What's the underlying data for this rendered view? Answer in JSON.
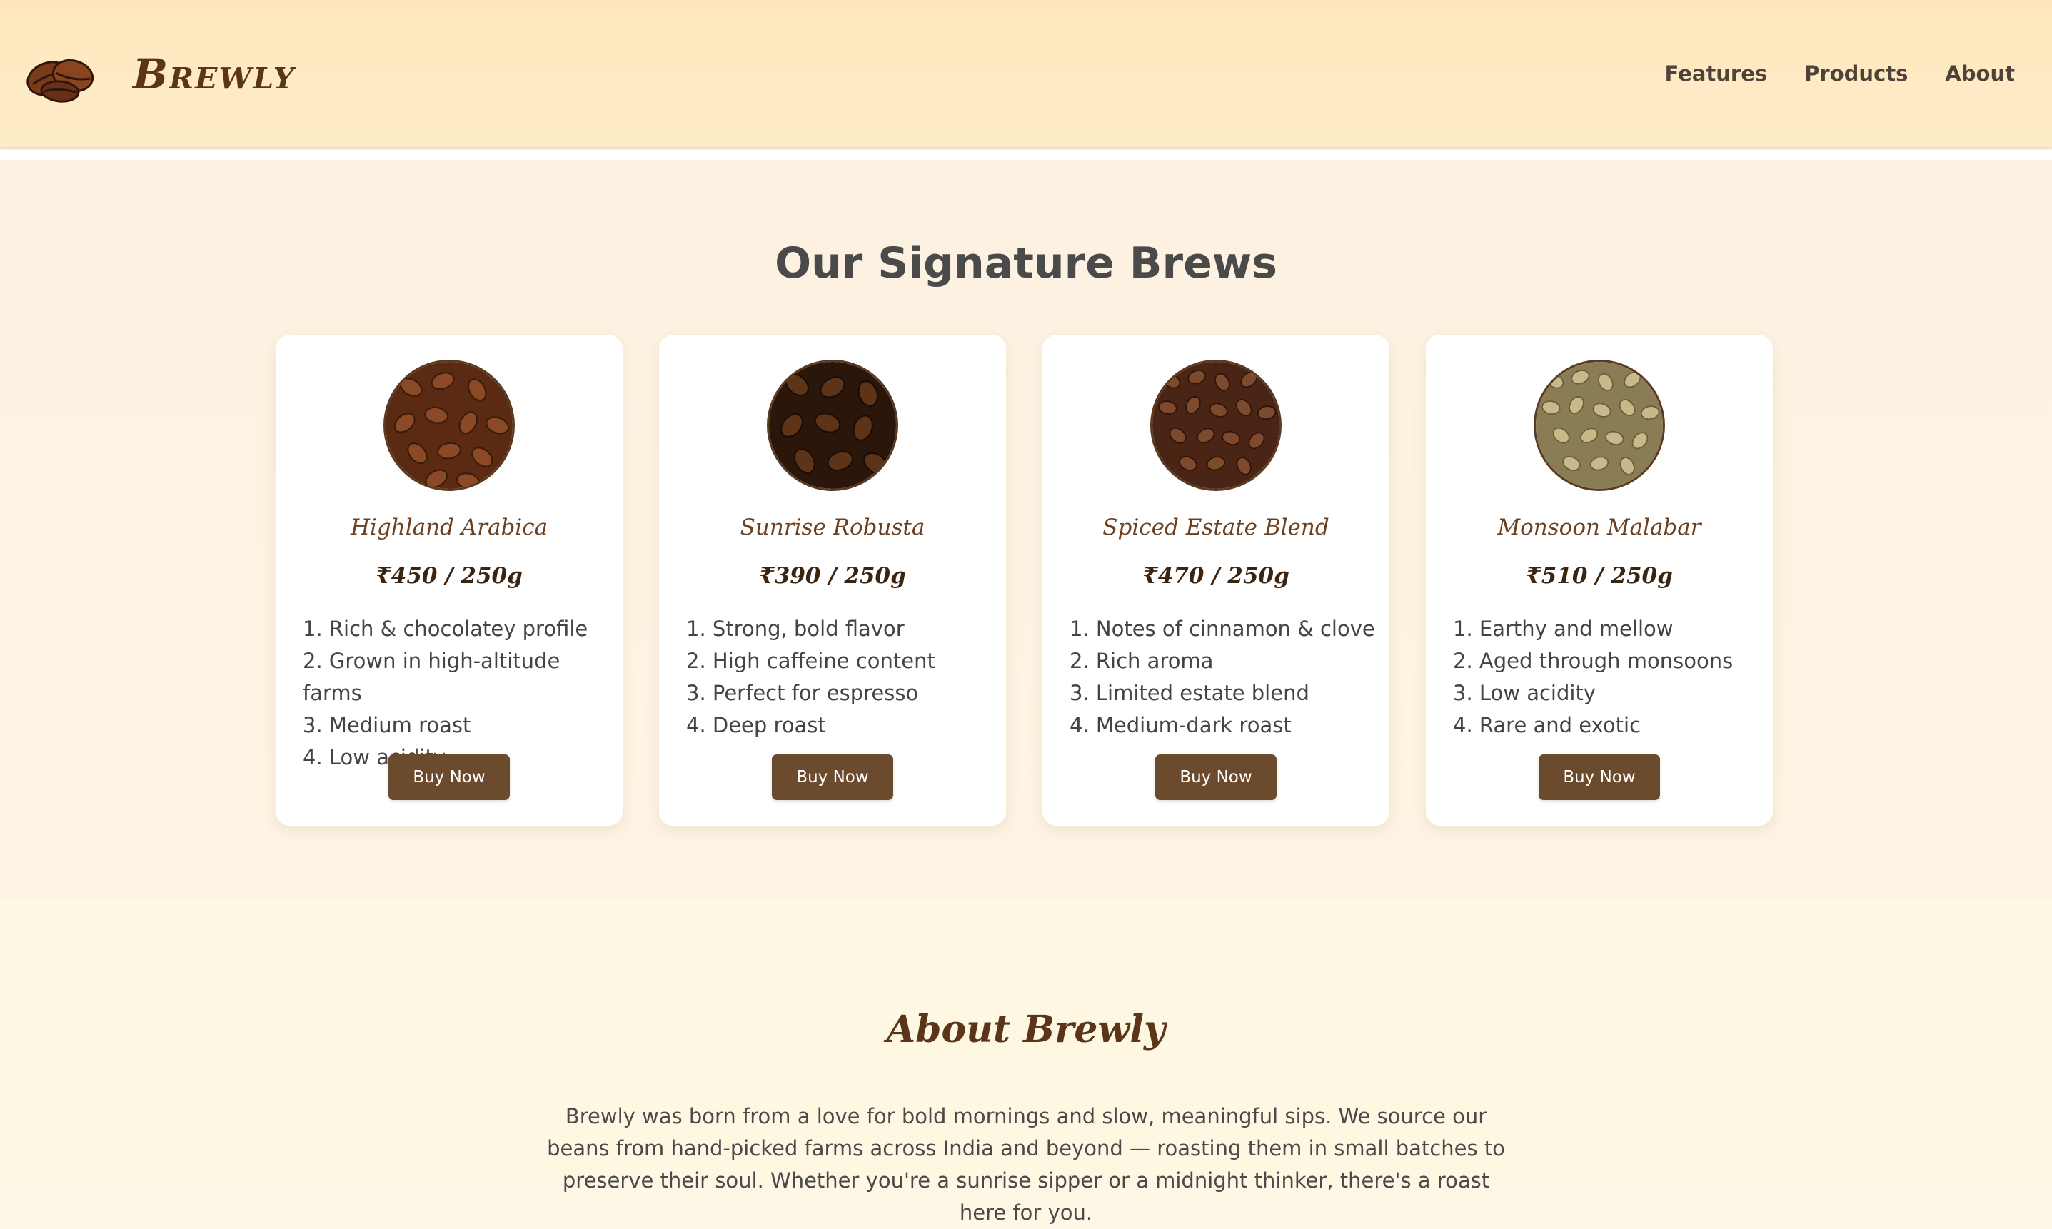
{
  "header": {
    "brand": "Brewly",
    "logo_icon": "coffee-beans-icon",
    "nav": [
      {
        "label": "Features"
      },
      {
        "label": "Products"
      },
      {
        "label": "About"
      }
    ]
  },
  "products": {
    "title": "Our Signature Brews",
    "cards": [
      {
        "name": "Highland Arabica",
        "price": "₹450 / 250g",
        "image_icon": "highland-arabica-beans-image",
        "features": [
          "1. Rich & chocolatey profile",
          "2. Grown in high-altitude farms",
          "3. Medium roast",
          "4. Low acidity"
        ],
        "button": "Buy Now"
      },
      {
        "name": "Sunrise Robusta",
        "price": "₹390 / 250g",
        "image_icon": "sunrise-robusta-beans-image",
        "features": [
          "1. Strong, bold flavor",
          "2. High caffeine content",
          "3. Perfect for espresso",
          "4. Deep roast"
        ],
        "button": "Buy Now"
      },
      {
        "name": "Spiced Estate Blend",
        "price": "₹470 / 250g",
        "image_icon": "spiced-estate-blend-beans-image",
        "features": [
          "1. Notes of cinnamon & clove",
          "2. Rich aroma",
          "3. Limited estate blend",
          "4. Medium-dark roast"
        ],
        "button": "Buy Now"
      },
      {
        "name": "Monsoon Malabar",
        "price": "₹510 / 250g",
        "image_icon": "monsoon-malabar-beans-image",
        "features": [
          "1. Earthy and mellow",
          "2. Aged through monsoons",
          "3. Low acidity",
          "4. Rare and exotic"
        ],
        "button": "Buy Now"
      }
    ]
  },
  "about": {
    "title": "About Brewly",
    "text": "Brewly was born from a love for bold mornings and slow, meaningful sips. We source our beans from hand-picked farms across India and beyond — roasting them in small batches to preserve their soul. Whether you're a sunrise sipper or a midnight thinker, there's a roast here for you."
  },
  "colors": {
    "header_bg": "#fee7bd",
    "brand": "#5a3519",
    "button_bg": "#6b4a2d",
    "section_bg": "#fdf2e2",
    "about_bg": "#fef8e3"
  }
}
